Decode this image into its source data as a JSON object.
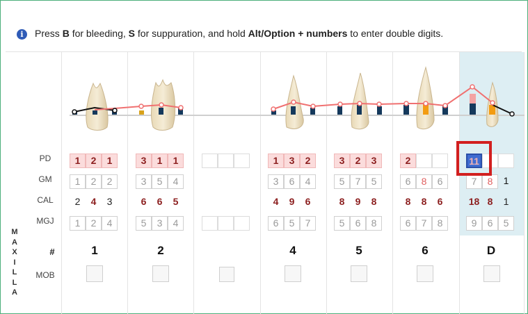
{
  "hint": {
    "p1": "Press ",
    "k1": "B",
    "p2": " for bleeding, ",
    "k2": "S",
    "p3": " for suppuration, and hold ",
    "k3": "Alt/Option + numbers",
    "p4": " to enter double digits."
  },
  "row_labels": {
    "pd": "PD",
    "gm": "GM",
    "cal": "CAL",
    "mgj": "MGJ",
    "hash": "#",
    "mob": "MOB"
  },
  "jaw_label": [
    "M",
    "A",
    "X",
    "I",
    "L",
    "L",
    "A"
  ],
  "teeth": [
    {
      "number": "1",
      "pd": [
        "1",
        "2",
        "1"
      ],
      "gm": [
        "1",
        "2",
        "2"
      ],
      "cal": [
        "2",
        "4",
        "3"
      ],
      "mgj": [
        "1",
        "2",
        "4"
      ]
    },
    {
      "number": "2",
      "pd": [
        "3",
        "1",
        "1"
      ],
      "gm": [
        "3",
        "5",
        "4"
      ],
      "cal": [
        "6",
        "6",
        "5"
      ],
      "mgj": [
        "5",
        "3",
        "4"
      ]
    },
    {
      "number": "",
      "pd": [
        "",
        "",
        ""
      ],
      "gm": [],
      "cal": [],
      "mgj": [
        "",
        "",
        ""
      ]
    },
    {
      "number": "4",
      "pd": [
        "1",
        "3",
        "2"
      ],
      "gm": [
        "3",
        "6",
        "4"
      ],
      "cal": [
        "4",
        "9",
        "6"
      ],
      "mgj": [
        "6",
        "5",
        "7"
      ]
    },
    {
      "number": "5",
      "pd": [
        "3",
        "2",
        "3"
      ],
      "gm": [
        "5",
        "7",
        "5"
      ],
      "cal": [
        "8",
        "9",
        "8"
      ],
      "mgj": [
        "5",
        "6",
        "8"
      ]
    },
    {
      "number": "6",
      "pd": [
        "2",
        "",
        ""
      ],
      "gm": [
        "6",
        "8",
        "6"
      ],
      "cal": [
        "8",
        "8",
        "6"
      ],
      "mgj": [
        "6",
        "7",
        "8"
      ]
    },
    {
      "number": "D",
      "pd": [
        "11",
        "",
        ""
      ],
      "gm": [
        "7",
        "8",
        "1"
      ],
      "cal": [
        "18",
        "8",
        "1"
      ],
      "mgj": [
        "9",
        "6",
        "5"
      ]
    }
  ],
  "colors": {
    "accent": "#3f6cd1",
    "pd_fill": "#fbdcdc",
    "chart_line": "#f07070",
    "highlight": "#d21f1f",
    "selected_column": "#ddeef3"
  }
}
